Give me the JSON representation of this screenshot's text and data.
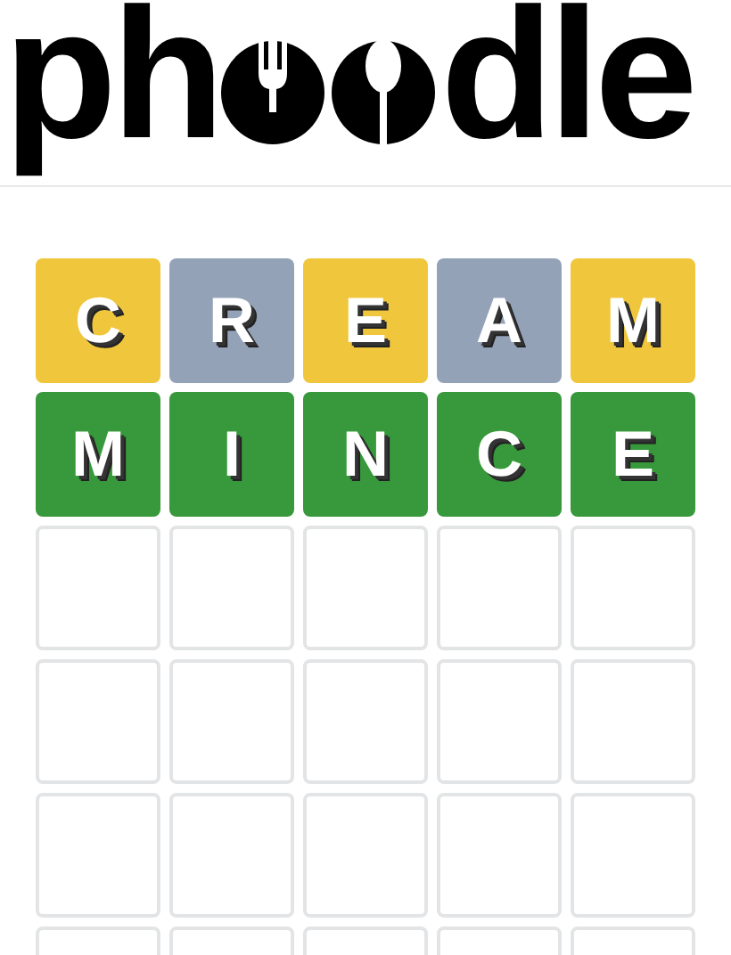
{
  "logo": {
    "start": "ph",
    "end": "dle"
  },
  "rows": [
    {
      "tiles": [
        {
          "letter": "C",
          "kind": "present"
        },
        {
          "letter": "R",
          "kind": "absent"
        },
        {
          "letter": "E",
          "kind": "present"
        },
        {
          "letter": "A",
          "kind": "absent"
        },
        {
          "letter": "M",
          "kind": "present"
        }
      ]
    },
    {
      "tiles": [
        {
          "letter": "M",
          "kind": "correct"
        },
        {
          "letter": "I",
          "kind": "correct"
        },
        {
          "letter": "N",
          "kind": "correct"
        },
        {
          "letter": "C",
          "kind": "correct"
        },
        {
          "letter": "E",
          "kind": "correct"
        }
      ]
    },
    {
      "tiles": [
        {
          "kind": "empty"
        },
        {
          "kind": "empty"
        },
        {
          "kind": "empty"
        },
        {
          "kind": "empty"
        },
        {
          "kind": "empty"
        }
      ]
    },
    {
      "tiles": [
        {
          "kind": "empty"
        },
        {
          "kind": "empty"
        },
        {
          "kind": "empty"
        },
        {
          "kind": "empty"
        },
        {
          "kind": "empty"
        }
      ]
    },
    {
      "tiles": [
        {
          "kind": "empty"
        },
        {
          "kind": "empty"
        },
        {
          "kind": "empty"
        },
        {
          "kind": "empty"
        },
        {
          "kind": "empty"
        }
      ]
    },
    {
      "tiles": [
        {
          "kind": "empty"
        },
        {
          "kind": "empty"
        },
        {
          "kind": "empty"
        },
        {
          "kind": "empty"
        },
        {
          "kind": "empty"
        }
      ]
    }
  ]
}
